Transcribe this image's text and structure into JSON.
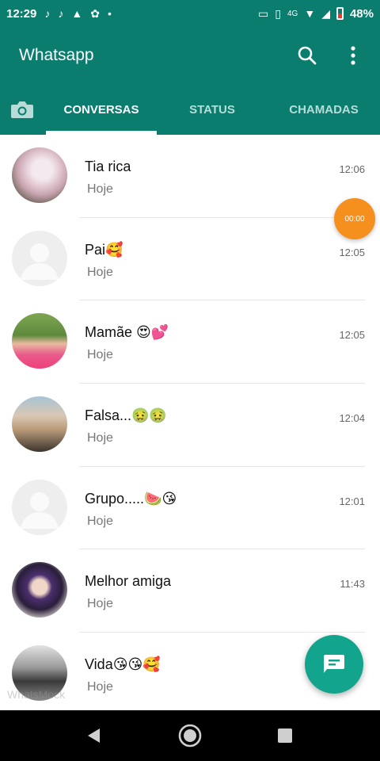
{
  "status_bar": {
    "time": "12:29",
    "network": "4G",
    "battery": "48%"
  },
  "app_bar": {
    "title": "Whatsapp",
    "search_icon": "search-icon",
    "menu_icon": "more-vert-icon"
  },
  "tabs": [
    {
      "label": "CONVERSAS",
      "active": true
    },
    {
      "label": "STATUS",
      "active": false
    },
    {
      "label": "CHAMADAS",
      "active": false
    }
  ],
  "chats": [
    {
      "name": "Tia rica",
      "preview": "Hoje",
      "time": "12:06",
      "avatar": "photo"
    },
    {
      "name": "Pai🥰",
      "preview": "Hoje",
      "time": "12:05",
      "avatar": "default"
    },
    {
      "name": "Mamãe 😍💕",
      "preview": "Hoje",
      "time": "12:05",
      "avatar": "photo"
    },
    {
      "name": "Falsa...🤢🤢",
      "preview": "Hoje",
      "time": "12:04",
      "avatar": "photo"
    },
    {
      "name": "Grupo.....🍉😘",
      "preview": "Hoje",
      "time": "12:01",
      "avatar": "default"
    },
    {
      "name": "Melhor amiga",
      "preview": "Hoje",
      "time": "11:43",
      "avatar": "photo"
    },
    {
      "name": "Vida😘😘🥰",
      "preview": "Hoje",
      "time": "",
      "avatar": "photo"
    }
  ],
  "recording_indicator": "00:00",
  "watermark": "WhatsMock",
  "colors": {
    "header": "#0a7d6e",
    "fab": "#12a48c",
    "recording": "#f5901e"
  }
}
